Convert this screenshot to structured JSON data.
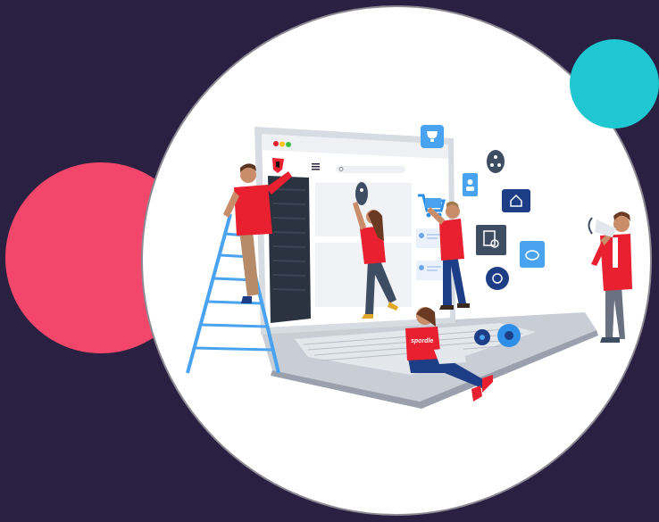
{
  "illustration": {
    "shirt_brand": "spordle",
    "colors": {
      "background": "#2a2142",
      "accent_red": "#f2466a",
      "accent_teal": "#1fc7d2",
      "shirt_red": "#e8202f",
      "icon_blue": "#2d8fe8",
      "icon_navy": "#1d3e86",
      "laptop_gray": "#cfd3da"
    },
    "floating_icons": [
      "trophy-icon",
      "person-badge-icon",
      "network-icon",
      "home-icon",
      "users-icon",
      "document-search-icon",
      "piggy-bank-icon",
      "gear-badge-icon",
      "shopping-cart-icon"
    ],
    "window_controls": [
      "#e8202f",
      "#f7c21a",
      "#3fbf3f"
    ]
  }
}
